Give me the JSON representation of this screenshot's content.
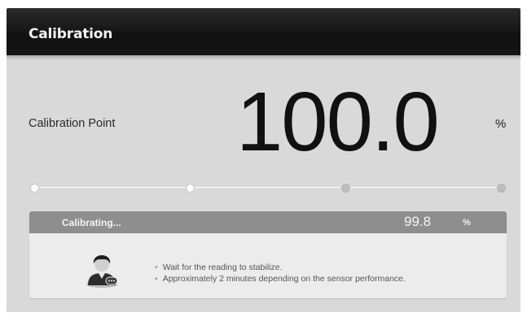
{
  "window": {
    "title": "Calibration"
  },
  "calibration": {
    "point_label": "Calibration Point",
    "target_value": "100.0",
    "target_unit": "%"
  },
  "progress": {
    "steps_total": 4,
    "steps_completed": 2
  },
  "status_panel": {
    "status_text": "Calibrating...",
    "current_reading": "99.8",
    "reading_unit": "%",
    "avatar_icon": "operator-avatar-icon",
    "instructions": [
      "Wait for the reading to stabilize.",
      "Approximately 2 minutes depending on the sensor performance."
    ]
  },
  "colors": {
    "titlebar": "#111111",
    "background": "#d9d9d9",
    "panel_header": "#8e8e8e",
    "panel_body": "#ececec"
  }
}
